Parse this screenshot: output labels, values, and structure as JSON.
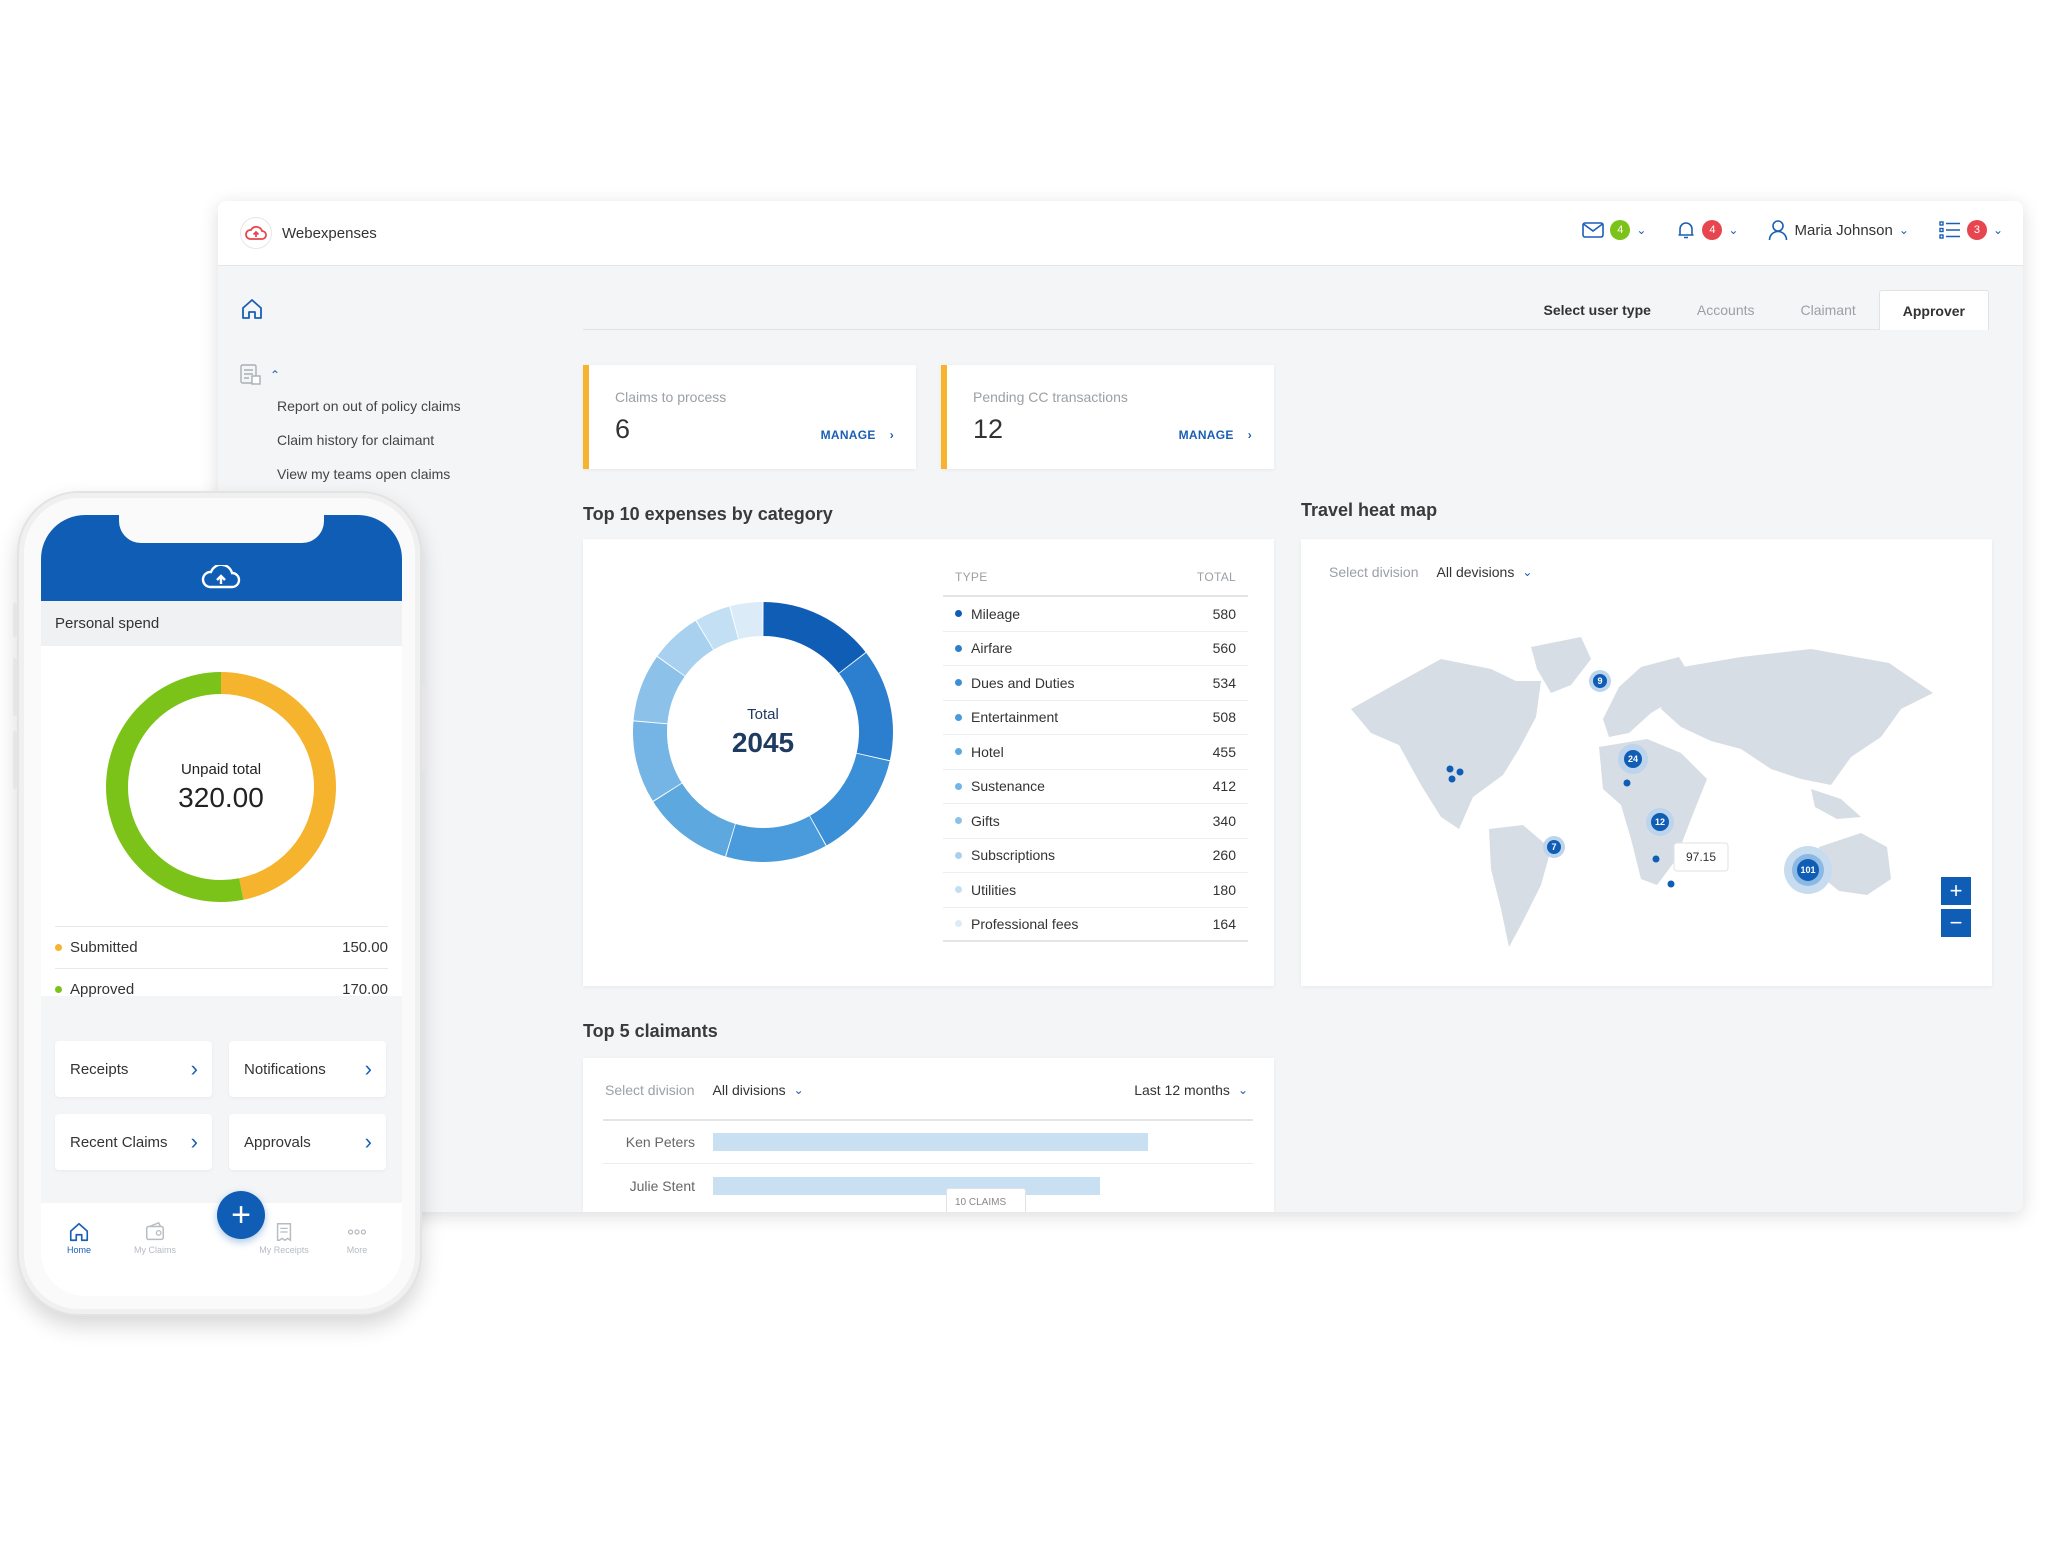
{
  "app": {
    "name": "Webexpenses"
  },
  "header": {
    "mail_count": "4",
    "alerts_count": "4",
    "user_name": "Maria Johnson",
    "tasks_count": "3"
  },
  "sidebar": {
    "links": [
      "Report on out of policy claims",
      "Claim history for claimant",
      "View my teams open claims"
    ]
  },
  "tabs": {
    "label": "Select user type",
    "items": [
      "Accounts",
      "Claimant",
      "Approver"
    ],
    "active": "Approver"
  },
  "kpis": [
    {
      "label": "Claims to process",
      "value": "6",
      "action": "MANAGE"
    },
    {
      "label": "Pending CC transactions",
      "value": "12",
      "action": "MANAGE"
    }
  ],
  "expenses": {
    "title": "Top 10 expenses by category",
    "total_label": "Total",
    "total_value": "2045",
    "col_type": "TYPE",
    "col_total": "TOTAL",
    "rows": [
      {
        "name": "Mileage",
        "value": "580",
        "color": "#0f5db5"
      },
      {
        "name": "Airfare",
        "value": "560",
        "color": "#2c7fcf"
      },
      {
        "name": "Dues and Duties",
        "value": "534",
        "color": "#3b8fd6"
      },
      {
        "name": "Entertainment",
        "value": "508",
        "color": "#4a9bdc"
      },
      {
        "name": "Hotel",
        "value": "455",
        "color": "#5ea8e0"
      },
      {
        "name": "Sustenance",
        "value": "412",
        "color": "#74b5e5"
      },
      {
        "name": "Gifts",
        "value": "340",
        "color": "#8cc2ea"
      },
      {
        "name": "Subscriptions",
        "value": "260",
        "color": "#a8d1ef"
      },
      {
        "name": "Utilities",
        "value": "180",
        "color": "#c2dff4"
      },
      {
        "name": "Professional fees",
        "value": "164",
        "color": "#dbecf8"
      }
    ]
  },
  "heatmap": {
    "title": "Travel heat map",
    "select_label": "Select division",
    "select_value": "All devisions",
    "clusters": [
      "9",
      "24",
      "12",
      "7",
      "101"
    ],
    "tooltip": "97.15"
  },
  "claimants": {
    "title": "Top 5 claimants",
    "select_label": "Select division",
    "select_value": "All divisions",
    "period": "Last 12 months",
    "rows": [
      {
        "name": "Ken Peters",
        "fraction": 1.0
      },
      {
        "name": "Julie Stent",
        "fraction": 0.89
      }
    ],
    "tooltip": "10 CLAIMS"
  },
  "phone": {
    "section_title": "Personal spend",
    "donut_label": "Unpaid total",
    "donut_value": "320.00",
    "rows": [
      {
        "label": "Submitted",
        "value": "150.00",
        "color": "#f5b32e"
      },
      {
        "label": "Approved",
        "value": "170.00",
        "color": "#7bc319"
      }
    ],
    "tiles": [
      "Receipts",
      "Notifications",
      "Recent Claims",
      "Approvals"
    ],
    "tabbar": [
      "Home",
      "My Claims",
      "My Receipts",
      "More"
    ]
  }
}
